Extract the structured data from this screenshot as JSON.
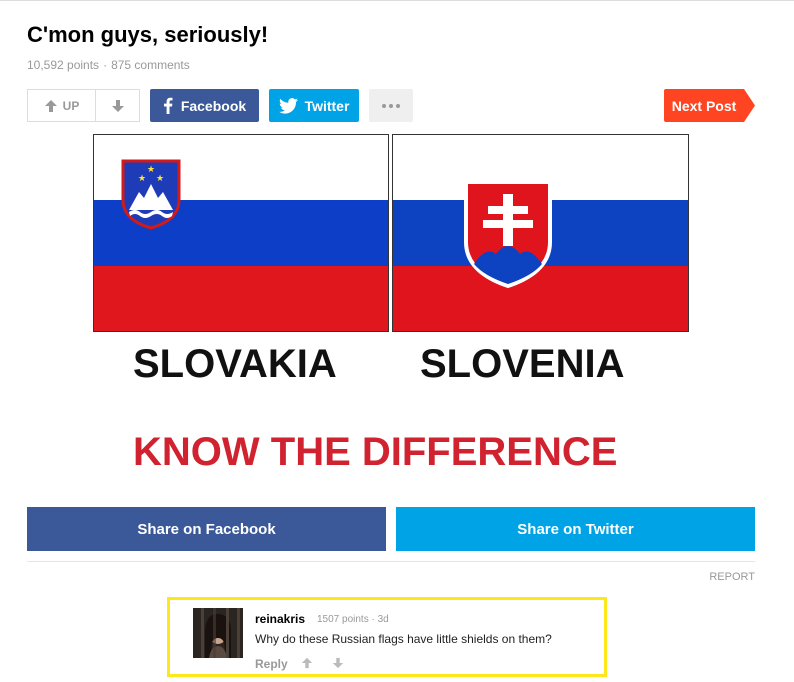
{
  "post": {
    "title": "C'mon guys, seriously!",
    "points": "10,592 points",
    "separator": "·",
    "comments": "875 comments"
  },
  "actions": {
    "upvote_label": "UP",
    "facebook_label": "Facebook",
    "twitter_label": "Twitter",
    "next_label": "Next Post"
  },
  "image": {
    "left_label": "SLOVAKIA",
    "right_label": "SLOVENIA",
    "caption": "KNOW THE DIFFERENCE"
  },
  "share": {
    "facebook": "Share on Facebook",
    "twitter": "Share on Twitter"
  },
  "report_label": "REPORT",
  "comment": {
    "user": "reinakris",
    "points": "1507 points",
    "separator": "·",
    "age": "3d",
    "text": "Why do these Russian flags have little shields on them?",
    "reply_label": "Reply"
  },
  "colors": {
    "facebook": "#3b5998",
    "twitter": "#00a3e5",
    "next": "#ff4422",
    "highlight": "#ffe81a",
    "caption_red": "#d1222f"
  }
}
